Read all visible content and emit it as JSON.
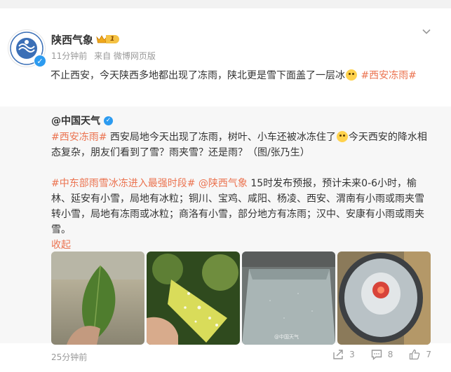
{
  "post": {
    "username": "陕西气象",
    "vip_level": "1",
    "time": "11分钟前",
    "source": "来自 微博网页版",
    "text_prefix": "不止西安，今天陕西多地都出现了冻雨，陕北更是雪下面盖了一层冰",
    "text_tag": "#西安冻雨#"
  },
  "repost": {
    "username": "@中国天气",
    "para1_tag": "#西安冻雨#",
    "para1_text_a": " 西安局地今天出现了冻雨，树叶、小车还被冰冻住了",
    "para1_text_b": "今天西安的降水相态复杂，朋友们看到了雪？雨夹雪？还是雨？（图/张乃生）",
    "para2_tag": "#中东部雨雪冰冻进入最强时段#",
    "para2_mention": " @陕西气象",
    "para2_text": " 15时发布预报，预计未来0-6小时，榆林、延安有小雪，局地有冰粒；铜川、宝鸡、咸阳、杨凌、西安、渭南有小雨或雨夹雪转小雪，局地有冻雨或冰粒；商洛有小雪，部分地方有冻雨；汉中、安康有小雨或雨夹雪。",
    "collapse_label": "收起",
    "photo_watermark": "@中国天气"
  },
  "footer": {
    "time": "25分钟前",
    "share_count": "3",
    "comment_count": "8",
    "like_count": "7"
  },
  "colors": {
    "link": "#eb7350",
    "verified": "#2c9bf0"
  }
}
